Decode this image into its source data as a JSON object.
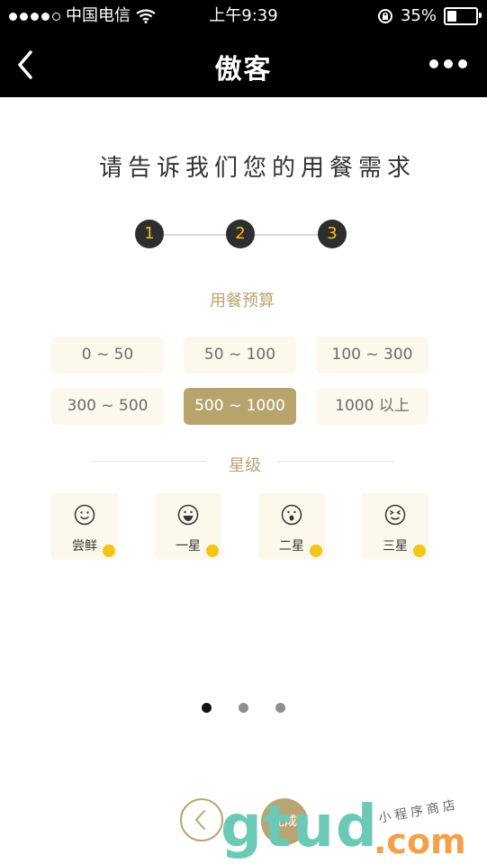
{
  "status_bar": {
    "carrier": "中国电信",
    "time": "上午9:39",
    "battery": "35%"
  },
  "nav": {
    "title": "傲客"
  },
  "heading": "请告诉我们您的用餐需求",
  "steps": [
    "1",
    "2",
    "3"
  ],
  "budget": {
    "label": "用餐预算",
    "options": [
      "0 ~ 50",
      "50 ~ 100",
      "100 ~ 300",
      "300 ~ 500",
      "500 ~ 1000",
      "1000 以上"
    ],
    "selected": "500 ~ 1000"
  },
  "star": {
    "label": "星级",
    "options": [
      {
        "label": "尝鲜",
        "icon": "smile-face-icon"
      },
      {
        "label": "一星",
        "icon": "grin-face-icon"
      },
      {
        "label": "二星",
        "icon": "surprised-face-icon"
      },
      {
        "label": "三星",
        "icon": "squint-face-icon"
      }
    ]
  },
  "bottom": {
    "finish_label": "完成"
  },
  "watermark": {
    "big": "gtud",
    "small": "小程序商店",
    "com": ".com"
  },
  "colors": {
    "accent": "#b7a46d",
    "step_number": "#f4c01e",
    "card_bg": "#fcf8eb"
  }
}
